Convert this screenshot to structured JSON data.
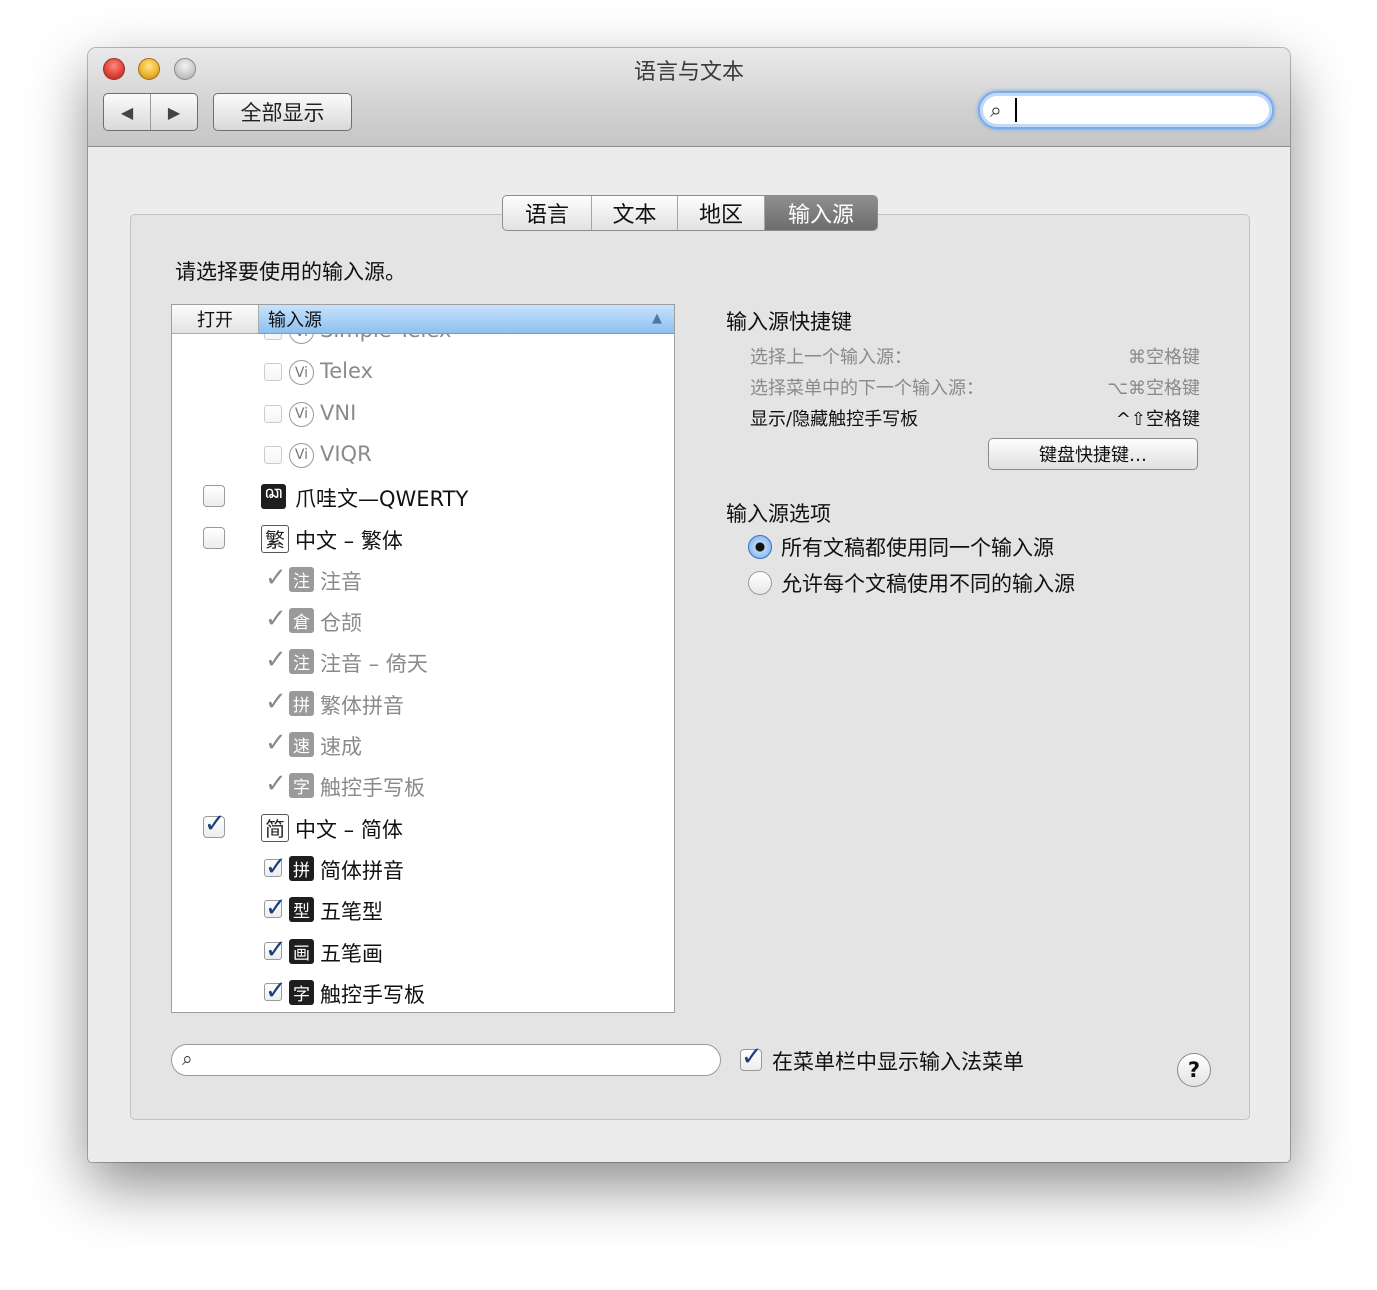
{
  "window": {
    "title": "语言与文本",
    "nav_back": "◀",
    "nav_forward": "▶",
    "show_all": "全部显示",
    "search_icon": "search-icon"
  },
  "tabs": [
    {
      "label": "语言",
      "selected": false
    },
    {
      "label": "文本",
      "selected": false
    },
    {
      "label": "地区",
      "selected": false
    },
    {
      "label": "输入源",
      "selected": true
    }
  ],
  "prompt": "请选择要使用的输入源。",
  "list": {
    "col_open": "打开",
    "col_source": "输入源",
    "rows": [
      {
        "label": "Simple Telex",
        "checked": false,
        "enabled": false,
        "badge": "vi"
      },
      {
        "label": "Telex",
        "checked": false,
        "enabled": false,
        "badge": "vi"
      },
      {
        "label": "VNI",
        "checked": false,
        "enabled": false,
        "badge": "vi"
      },
      {
        "label": "VIQR",
        "checked": false,
        "enabled": false,
        "badge": "vi"
      },
      {
        "label": "爪哇文—QWERTY",
        "checked": false,
        "enabled": true,
        "badge": "ꦕ"
      },
      {
        "label": "中文 – 繁体",
        "checked": false,
        "enabled": true,
        "badge": "繁"
      },
      {
        "label": "注音",
        "checked": true,
        "enabled": false,
        "badge": "注"
      },
      {
        "label": "仓颉",
        "checked": true,
        "enabled": false,
        "badge": "倉"
      },
      {
        "label": "注音 – 倚天",
        "checked": true,
        "enabled": false,
        "badge": "注"
      },
      {
        "label": "繁体拼音",
        "checked": true,
        "enabled": false,
        "badge": "拼"
      },
      {
        "label": "速成",
        "checked": true,
        "enabled": false,
        "badge": "速"
      },
      {
        "label": "触控手写板",
        "checked": true,
        "enabled": false,
        "badge": "字"
      },
      {
        "label": "中文 – 简体",
        "checked": true,
        "enabled": true,
        "badge": "简"
      },
      {
        "label": "简体拼音",
        "checked": true,
        "enabled": true,
        "badge": "拼"
      },
      {
        "label": "五笔型",
        "checked": true,
        "enabled": true,
        "badge": "型"
      },
      {
        "label": "五笔画",
        "checked": true,
        "enabled": true,
        "badge": "画"
      },
      {
        "label": "触控手写板",
        "checked": true,
        "enabled": true,
        "badge": "字"
      }
    ]
  },
  "shortcuts": {
    "title": "输入源快捷键",
    "items": [
      {
        "label": "选择上一个输入源：",
        "key": "⌘空格键"
      },
      {
        "label": "选择菜单中的下一个输入源：",
        "key": "⌥⌘空格键"
      },
      {
        "label": "显示/隐藏触控手写板",
        "key": "^⇧空格键"
      }
    ],
    "button": "键盘快捷键…"
  },
  "options": {
    "title": "输入源选项",
    "radio_same": "所有文稿都使用同一个输入源",
    "radio_diff": "允许每个文稿使用不同的输入源",
    "selected": "same"
  },
  "bottom": {
    "show_menu_label": "在菜单栏中显示输入法菜单",
    "show_menu_checked": true,
    "help": "?"
  }
}
